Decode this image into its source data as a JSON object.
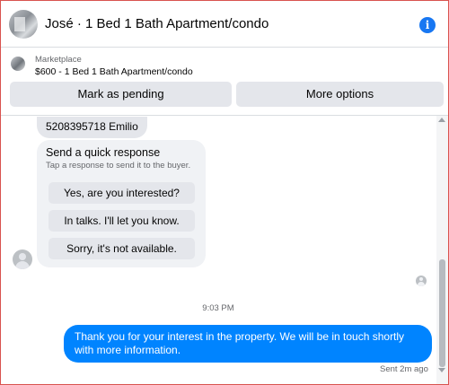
{
  "header": {
    "title": "José · 1 Bed 1 Bath Apartment/condo",
    "info_icon": "info-icon"
  },
  "listing": {
    "source": "Marketplace",
    "price_title": "$600 - 1 Bed 1 Bath Apartment/condo",
    "buttons": {
      "mark_pending": "Mark as pending",
      "more_options": "More options"
    }
  },
  "chat": {
    "incoming_message": "5208395718 Emilio",
    "quick_response": {
      "title": "Send a quick response",
      "subtitle": "Tap a response to send it to the buyer.",
      "options": [
        "Yes, are you interested?",
        "In talks. I'll let you know.",
        "Sorry, it's not available."
      ]
    },
    "timestamp": "9:03 PM",
    "outgoing_message": "Thank you for your interest in the property. We will be in touch shortly with more information.",
    "sent_status": "Sent 2m ago"
  },
  "colors": {
    "accent": "#1877f2",
    "outgoing_bubble": "#0084ff",
    "button_bg": "#e4e6eb",
    "secondary_text": "#65676b"
  }
}
